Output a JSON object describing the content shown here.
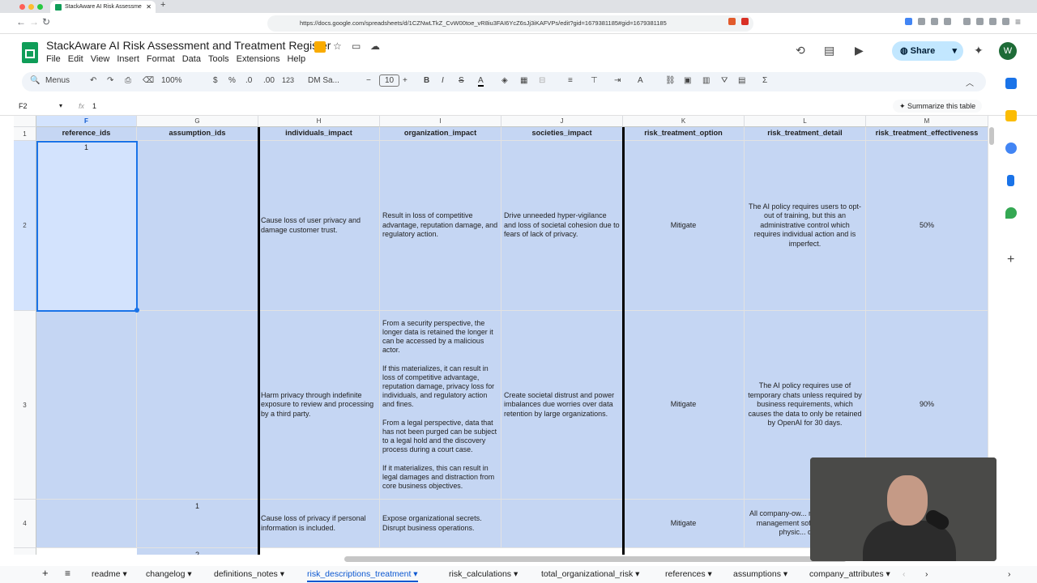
{
  "browser": {
    "tab_title": "StackAware AI Risk Assessme",
    "url": "https://docs.google.com/spreadsheets/d/1CZNwLTkZ_CvW00toe_vR8iu3FAI6YcZ6sJj3iKAFVPs/edit?gid=1679381185#gid=1679381185"
  },
  "doc": {
    "title": "StackAware AI Risk Assessment and Treatment Register",
    "menus": [
      "File",
      "Edit",
      "View",
      "Insert",
      "Format",
      "Data",
      "Tools",
      "Extensions",
      "Help"
    ],
    "share_label": "Share",
    "avatar": "W"
  },
  "toolbar": {
    "menus": "Menus",
    "zoom": "100%",
    "currency": "$",
    "percent": "%",
    "dec_less": ".0",
    "dec_more": ".00",
    "format123": "123",
    "font": "DM Sa...",
    "font_size": "10"
  },
  "formula": {
    "namebox": "F2",
    "fx": "fx",
    "value": "1",
    "summarize": "Summarize this table"
  },
  "columns": [
    "F",
    "G",
    "H",
    "I",
    "J",
    "K",
    "L",
    "M"
  ],
  "headers": [
    "reference_ids",
    "assumption_ids",
    "individuals_impact",
    "organization_impact",
    "societies_impact",
    "risk_treatment_option",
    "risk_treatment_detail",
    "risk_treatment_effectiveness"
  ],
  "rows": [
    {
      "num": "1"
    },
    {
      "num": "2",
      "F": "1",
      "G": "",
      "H": "Cause loss of user privacy and damage customer trust.",
      "I": "Result in loss of competitive advantage, reputation damage, and regulatory action.",
      "J": "Drive unneeded hyper-vigilance and loss of societal cohesion due to fears of lack of privacy.",
      "K": "Mitigate",
      "L": "The AI policy requires users to opt-out of training, but this an administrative control which requires individual action and is imperfect.",
      "M": "50%"
    },
    {
      "num": "3",
      "F": "",
      "G": "",
      "H": "Harm privacy through indefinite exposure to review and processing by a third party.",
      "I": "From a security perspective, the longer data is retained the longer it can be accessed by a malicious actor.\n\nIf this materializes, it can result in loss of competitive advantage, reputation damage, privacy loss for individuals, and regulatory action and fines.\n\nFrom a legal perspective, data that has not been purged can be subject to a legal hold and the discovery process during a court case.\n\nIf it materializes, this can result in legal damages and distraction from core business objectives.",
      "J": "Create societal distrust and power imbalances due worries over data retention by large organizations.",
      "K": "Mitigate",
      "L": "The AI policy requires use of temporary chats unless required by business requirements, which causes the data to only be retained by OpenAI for 30 days.",
      "M": "90%"
    },
    {
      "num": "4",
      "F": "",
      "G": "1",
      "H": "Cause loss of privacy if personal information is included.",
      "I": "Expose organizational secrets. Disrupt business operations.",
      "J": "",
      "K": "Mitigate",
      "L": "All company-ow... must have mo... management soft... which can physic... devic...",
      "M": ""
    },
    {
      "num": "",
      "F": "",
      "G": "2"
    }
  ],
  "sheet_tabs": [
    "readme",
    "changelog",
    "definitions_notes",
    "risk_descriptions_treatment",
    "risk_calculations",
    "total_organizational_risk",
    "references",
    "assumptions",
    "company_attributes"
  ],
  "active_tab": "risk_descriptions_treatment",
  "colors": {
    "selection": "#c5d6f3",
    "accent": "#0b57d0",
    "sheets_green": "#0f9d58"
  }
}
